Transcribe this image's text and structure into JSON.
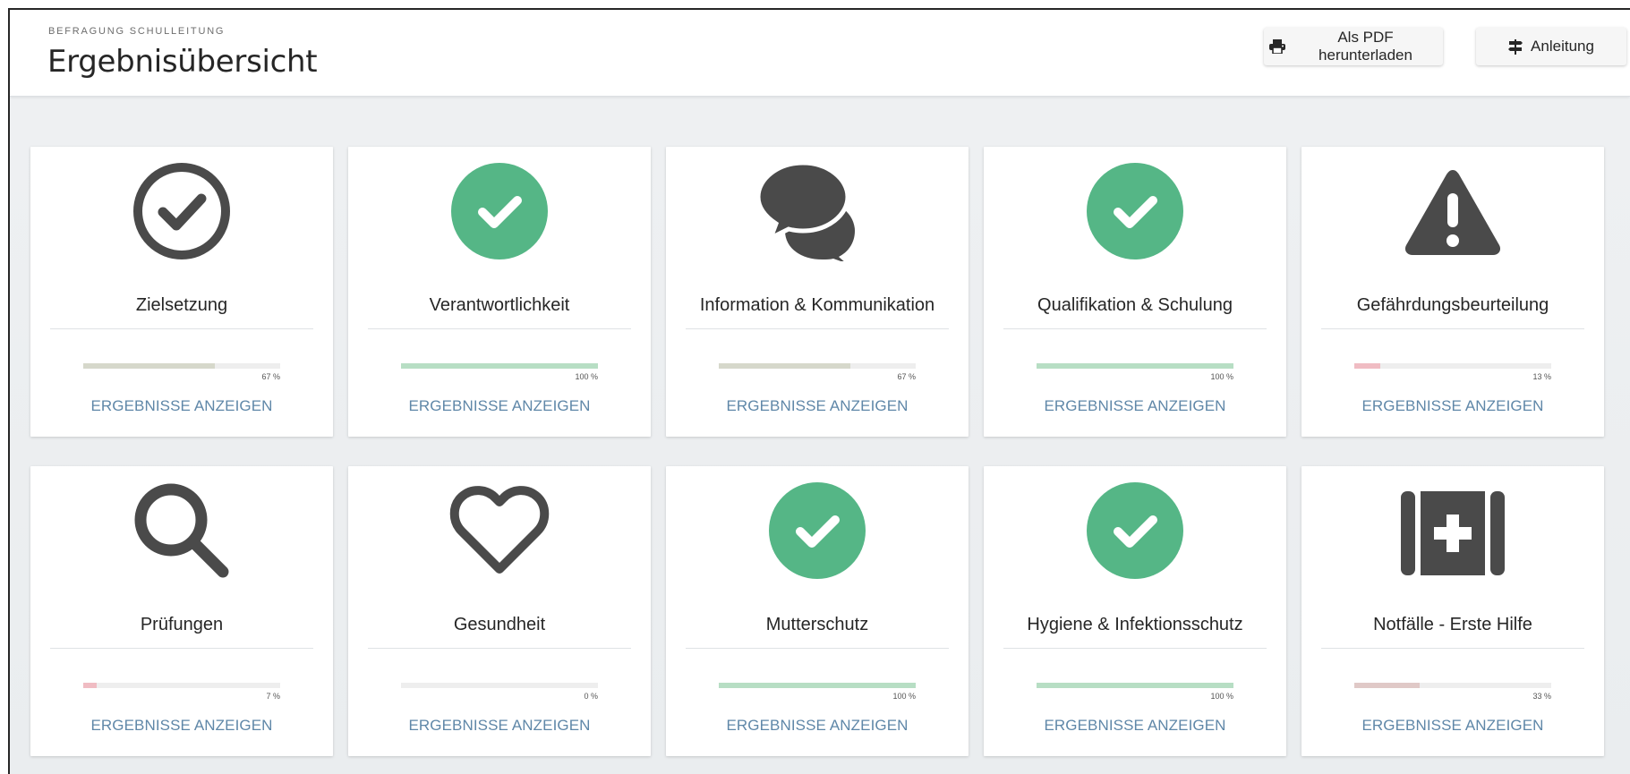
{
  "header": {
    "eyebrow": "BEFRAGUNG SCHULLEITUNG",
    "title": "Ergebnisübersicht",
    "buttons": {
      "pdf_label": "Als PDF herunterladen",
      "pdf_icon": "print-icon",
      "guide_label": "Anleitung",
      "guide_icon": "signpost-icon"
    }
  },
  "colors": {
    "success_green": "#55b686",
    "icon_dark": "#4a4a4a",
    "link_blue": "#5f87a8",
    "bar_done": "#b7dec4",
    "bar_partial": "#d6d8cb",
    "bar_low": "#f0bcc3",
    "bar_third": "#e0c9c7",
    "page_background": "#eceff1"
  },
  "cards": [
    {
      "title": "Zielsetzung",
      "icon": "check-circle-outline-icon",
      "progress": 67,
      "percent_label": "67 %",
      "bar_color": "#d6d8cb",
      "link": "ERGEBNISSE ANZEIGEN"
    },
    {
      "title": "Verantwortlichkeit",
      "icon": "check-circle-green-icon",
      "progress": 100,
      "percent_label": "100 %",
      "bar_color": "#b7dec4",
      "link": "ERGEBNISSE ANZEIGEN"
    },
    {
      "title": "Information & Kommunikation",
      "icon": "speech-bubbles-icon",
      "progress": 67,
      "percent_label": "67 %",
      "bar_color": "#d6d8cb",
      "link": "ERGEBNISSE ANZEIGEN"
    },
    {
      "title": "Qualifikation & Schulung",
      "icon": "check-circle-green-icon",
      "progress": 100,
      "percent_label": "100 %",
      "bar_color": "#b7dec4",
      "link": "ERGEBNISSE ANZEIGEN"
    },
    {
      "title": "Gefährdungsbeurteilung",
      "icon": "warning-triangle-icon",
      "progress": 13,
      "percent_label": "13 %",
      "bar_color": "#f0bcc3",
      "link": "ERGEBNISSE ANZEIGEN"
    },
    {
      "title": "Prüfungen",
      "icon": "magnifier-icon",
      "progress": 7,
      "percent_label": "7 %",
      "bar_color": "#f0bcc3",
      "link": "ERGEBNISSE ANZEIGEN"
    },
    {
      "title": "Gesundheit",
      "icon": "heart-outline-icon",
      "progress": 0,
      "percent_label": "0 %",
      "bar_color": "#f0bcc3",
      "link": "ERGEBNISSE ANZEIGEN"
    },
    {
      "title": "Mutterschutz",
      "icon": "check-circle-green-icon",
      "progress": 100,
      "percent_label": "100 %",
      "bar_color": "#b7dec4",
      "link": "ERGEBNISSE ANZEIGEN"
    },
    {
      "title": "Hygiene & Infektionsschutz",
      "icon": "check-circle-green-icon",
      "progress": 100,
      "percent_label": "100 %",
      "bar_color": "#b7dec4",
      "link": "ERGEBNISSE ANZEIGEN"
    },
    {
      "title": "Notfälle - Erste Hilfe",
      "icon": "first-aid-kit-icon",
      "progress": 33,
      "percent_label": "33 %",
      "bar_color": "#e0c9c7",
      "link": "ERGEBNISSE ANZEIGEN"
    }
  ]
}
